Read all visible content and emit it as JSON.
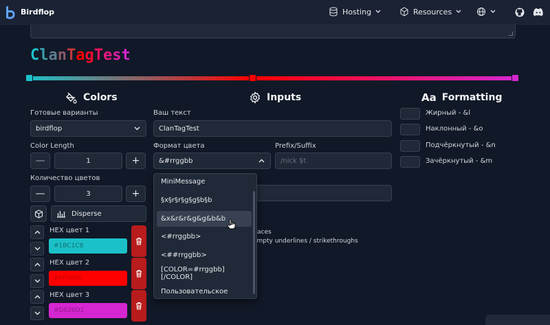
{
  "header": {
    "brand": "Birdflop",
    "nav": [
      {
        "label": "Hosting",
        "icon": "database-icon"
      },
      {
        "label": "Resources",
        "icon": "cube-icon"
      }
    ],
    "icons": [
      "globe-icon",
      "github-icon",
      "discord-icon"
    ]
  },
  "preview": {
    "text": "ClanTagTest",
    "letter_colors": [
      "#1BC1C8",
      "#3A9FAA",
      "#5D7F8F",
      "#8A5C6B",
      "#C23B3A",
      "#FF0000",
      "#F20A2C",
      "#EC1258",
      "#E51983",
      "#DD1FAA",
      "#D626D1"
    ]
  },
  "gradient": {
    "stops": [
      {
        "color": "#1BC1C8",
        "position": 0
      },
      {
        "color": "#FF0000",
        "position": 0.46
      },
      {
        "color": "#D626D1",
        "position": 1
      }
    ]
  },
  "colors": {
    "title": "Colors",
    "presets_label": "Готовые варианты",
    "preset_value": "birdflop",
    "length_label": "Color Length",
    "length_value": "1",
    "count_label": "Количество цветов",
    "count_value": "3",
    "disperse_label": "Disperse",
    "minus": "—",
    "plus": "+",
    "entries": [
      {
        "label": "HEX цвет 1",
        "value": "#1BC1C8",
        "bg": "#1BC1C8",
        "fg": "#0e6e73"
      },
      {
        "label": "HEX цвет 2",
        "value": "#FF0000",
        "bg": "#FF0000",
        "fg": "#c40000"
      },
      {
        "label": "HEX цвет 3",
        "value": "#D626D1",
        "bg": "#D626D1",
        "fg": "#8f1a8c"
      }
    ]
  },
  "inputs": {
    "title": "Inputs",
    "text_label": "Ваш текст",
    "text_value": "ClanTagTest",
    "format_label": "Формат цвета",
    "format_value": "&#rrggbb",
    "prefix_label": "Prefix/Suffix",
    "prefix_placeholder": "/nick $t",
    "options": [
      "MiniMessage",
      "§x§r§r§g§g§b§b",
      "&x&r&r&g&g&b&b",
      "<#rrggbb>",
      "<##rrggbb>",
      "[COLOR=#rrggbb][/COLOR]",
      "Пользовательское"
    ],
    "highlighted_index": 2,
    "partial_1": "aces",
    "partial_2": "empty underlines / strikethroughs"
  },
  "formatting": {
    "title": "Formatting",
    "options": [
      "Жирный - &l",
      "Наклонный - &o",
      "Подчёркнутый - &n",
      "Зачёркнутый - &m"
    ]
  }
}
